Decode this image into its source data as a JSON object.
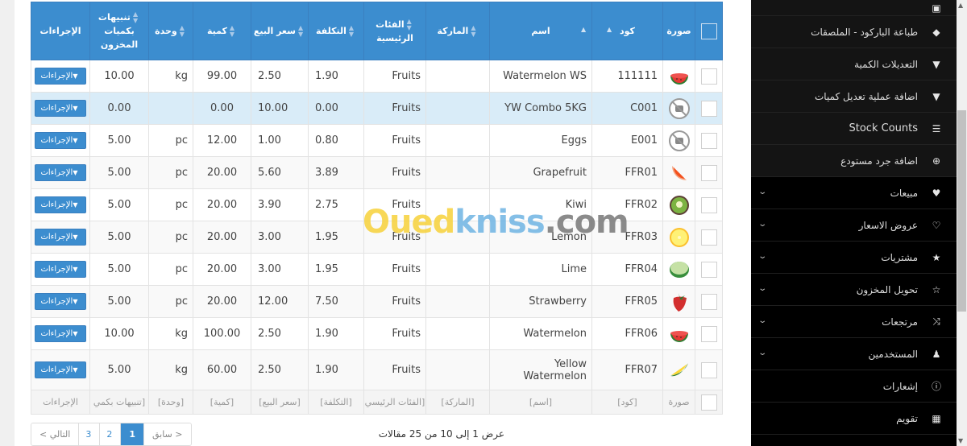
{
  "table": {
    "headers": {
      "actions": "الإجراءات",
      "alert_qty": "تنبيهات بكميات المخزون",
      "unit": "وحدة",
      "quantity": "كمية",
      "price": "سعر البيع",
      "cost": "التكلفة",
      "category": "الفئات الرئيسية",
      "brand": "الماركة",
      "name": "اسم",
      "code": "كود",
      "image": "صورة"
    },
    "action_label": "الإجراءات",
    "rows": [
      {
        "code": "111111",
        "name": "Watermelon WS",
        "brand": "",
        "category": "Fruits",
        "cost": "1.90",
        "price": "2.50",
        "quantity": "99.00",
        "unit": "kg",
        "alert_qty": "10.00",
        "image": "watermelon-icon"
      },
      {
        "code": "C001",
        "name": "YW Combo 5KG",
        "brand": "",
        "category": "Fruits",
        "cost": "0.00",
        "price": "10.00",
        "quantity": "0.00",
        "unit": "",
        "alert_qty": "0.00",
        "image": "no-image-icon"
      },
      {
        "code": "E001",
        "name": "Eggs",
        "brand": "",
        "category": "Fruits",
        "cost": "0.80",
        "price": "1.00",
        "quantity": "12.00",
        "unit": "pc",
        "alert_qty": "5.00",
        "image": "no-image-icon"
      },
      {
        "code": "FFR01",
        "name": "Grapefruit",
        "brand": "",
        "category": "Fruits",
        "cost": "3.89",
        "price": "5.60",
        "quantity": "20.00",
        "unit": "pc",
        "alert_qty": "5.00",
        "image": "grapefruit-icon"
      },
      {
        "code": "FFR02",
        "name": "Kiwi",
        "brand": "",
        "category": "Fruits",
        "cost": "2.75",
        "price": "3.90",
        "quantity": "20.00",
        "unit": "pc",
        "alert_qty": "5.00",
        "image": "kiwi-icon"
      },
      {
        "code": "FFR03",
        "name": "Lemon",
        "brand": "",
        "category": "Fruits",
        "cost": "1.95",
        "price": "3.00",
        "quantity": "20.00",
        "unit": "pc",
        "alert_qty": "5.00",
        "image": "lemon-icon"
      },
      {
        "code": "FFR04",
        "name": "Lime",
        "brand": "",
        "category": "Fruits",
        "cost": "1.95",
        "price": "3.00",
        "quantity": "20.00",
        "unit": "pc",
        "alert_qty": "5.00",
        "image": "lime-icon"
      },
      {
        "code": "FFR05",
        "name": "Strawberry",
        "brand": "",
        "category": "Fruits",
        "cost": "7.50",
        "price": "12.00",
        "quantity": "20.00",
        "unit": "pc",
        "alert_qty": "5.00",
        "image": "strawberry-icon"
      },
      {
        "code": "FFR06",
        "name": "Watermelon",
        "brand": "",
        "category": "Fruits",
        "cost": "1.90",
        "price": "2.50",
        "quantity": "100.00",
        "unit": "kg",
        "alert_qty": "10.00",
        "image": "watermelon-icon"
      },
      {
        "code": "FFR07",
        "name": "Yellow Watermelon",
        "brand": "",
        "category": "Fruits",
        "cost": "1.90",
        "price": "2.50",
        "quantity": "60.00",
        "unit": "kg",
        "alert_qty": "5.00",
        "image": "yellow-watermelon-icon"
      }
    ],
    "footer": {
      "actions": "الإجراءات",
      "alert_qty": "[تنبيهات بكمي",
      "unit": "[وحدة]",
      "quantity": "[كمية]",
      "price": "[سعر البيع]",
      "cost": "[التكلفة]",
      "category": "[الفئات الرئيسي",
      "brand": "[الماركة]",
      "name": "[اسم]",
      "code": "[كود]",
      "image": "صورة"
    }
  },
  "pagination": {
    "next": "التالي >",
    "pages": [
      "3",
      "2",
      "1"
    ],
    "active_page": "1",
    "prev": "< سابق",
    "info": "عرض 1 إلى 10 من 25 مقالات"
  },
  "watermark": {
    "part1": "Oued",
    "part2": "kniss",
    "part3": ".com"
  },
  "sidebar": {
    "items": [
      {
        "label": "",
        "icon": "document-icon",
        "sub": true
      },
      {
        "label": "طباعة الباركود - الملصقات",
        "icon": "tags-icon",
        "sub": true
      },
      {
        "label": "التعديلات الكمية",
        "icon": "filter-icon",
        "sub": true
      },
      {
        "label": "اضافة عملية تعديل كميات",
        "icon": "filter-icon",
        "sub": true
      },
      {
        "label": "Stock Counts",
        "icon": "list-icon",
        "sub": true
      },
      {
        "label": "اضافة جرد مستودع",
        "icon": "plus-circle-icon",
        "sub": true
      },
      {
        "label": "مبيعات",
        "icon": "heart-icon",
        "chevron": true
      },
      {
        "label": "عروض الاسعار",
        "icon": "heart-outline-icon",
        "chevron": true
      },
      {
        "label": "مشتريات",
        "icon": "star-icon",
        "chevron": true
      },
      {
        "label": "تحويل المخزون",
        "icon": "star-outline-icon",
        "chevron": true
      },
      {
        "label": "مرتجعات",
        "icon": "random-icon",
        "chevron": true
      },
      {
        "label": "المستخدمين",
        "icon": "users-icon",
        "chevron": true
      },
      {
        "label": "إشعارات",
        "icon": "info-icon"
      },
      {
        "label": "تقويم",
        "icon": "calendar-icon"
      }
    ]
  },
  "colors": {
    "accent": "#3c8dcf",
    "sidebar_bg": "#000000",
    "highlight_row": "#d9ecf8"
  }
}
